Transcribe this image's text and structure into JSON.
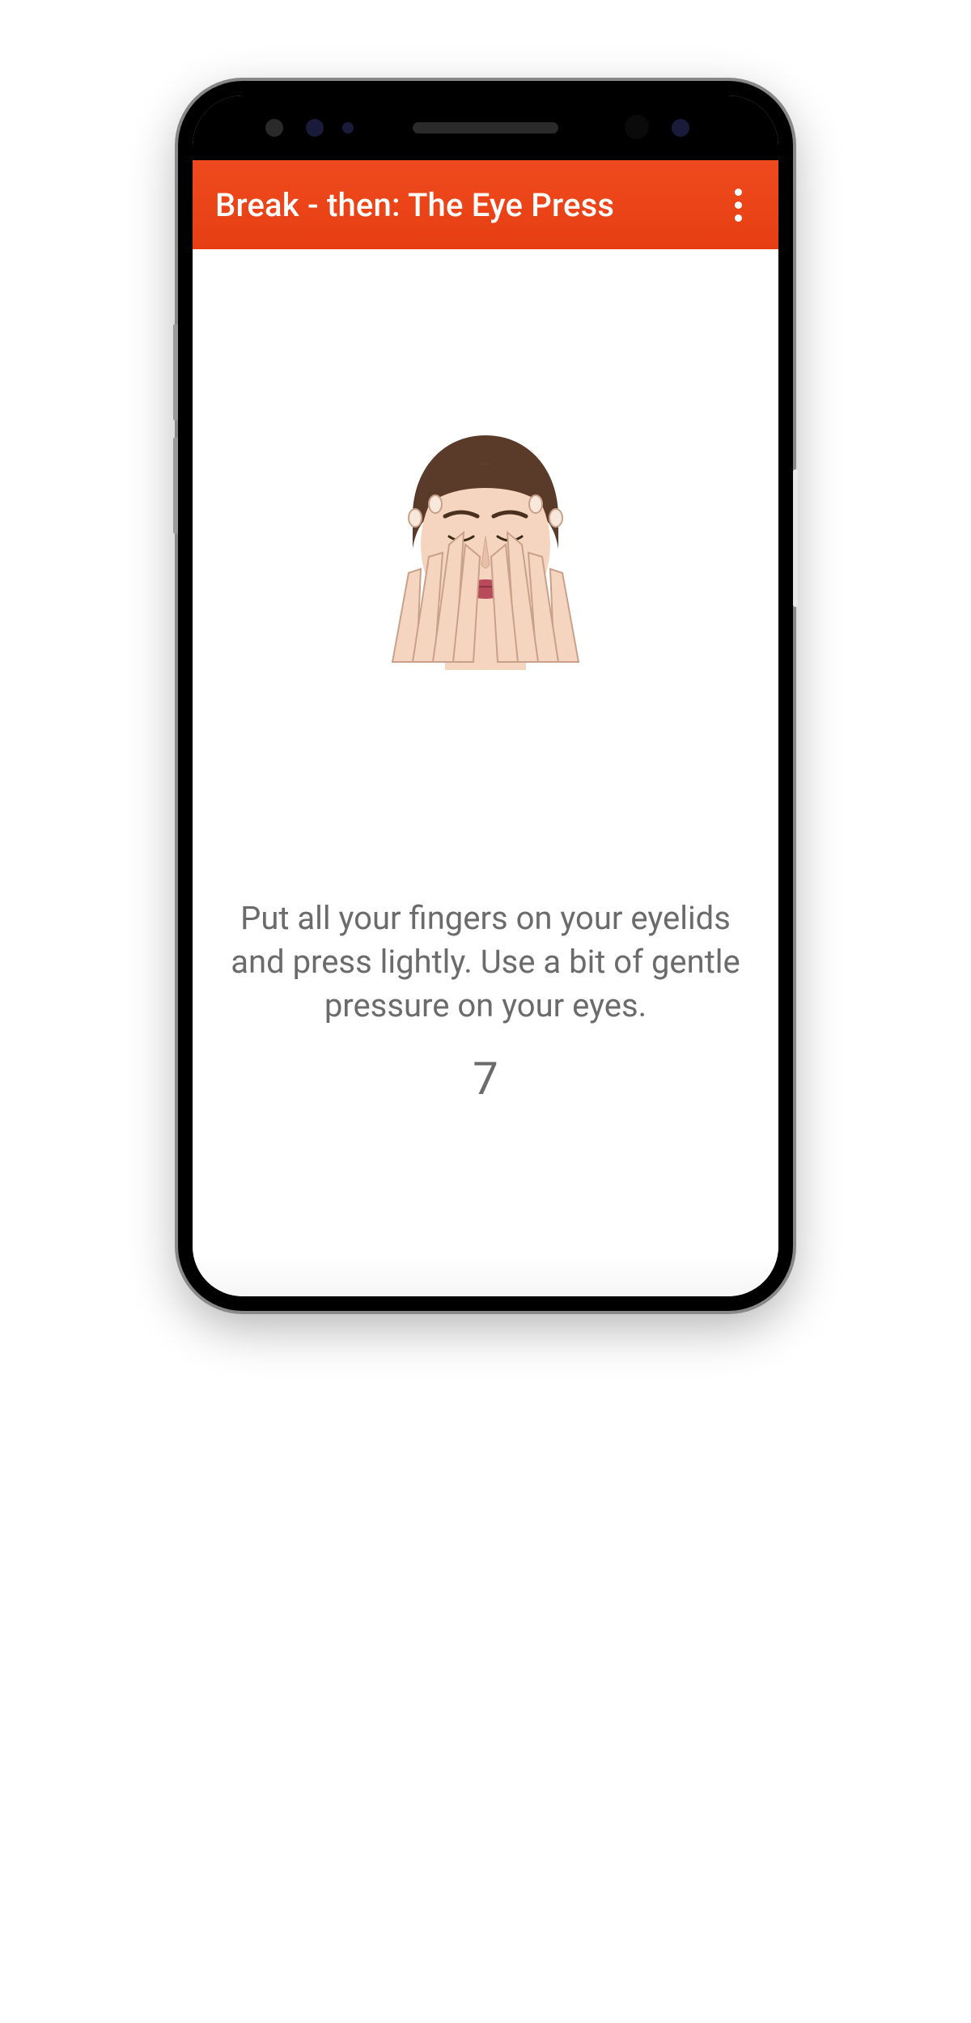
{
  "header": {
    "title": "Break - then: The Eye Press"
  },
  "content": {
    "instruction": "Put all your fingers on your eyelids and press lightly. Use a bit of gentle pressure on your eyes.",
    "countdown": "7"
  }
}
